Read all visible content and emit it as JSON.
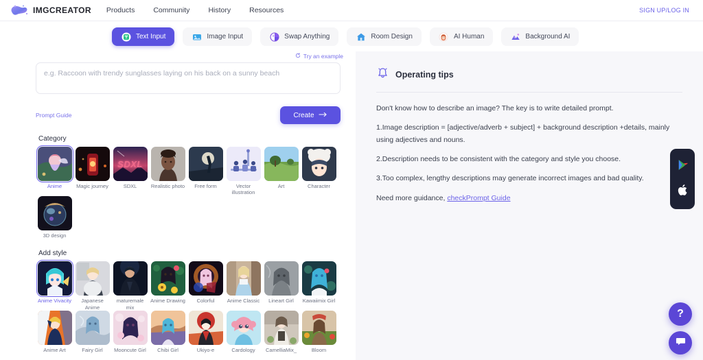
{
  "header": {
    "logo_text": "IMGCREATOR",
    "logo_icon": "blob-logo-icon",
    "nav": [
      {
        "label": "Products"
      },
      {
        "label": "Community"
      },
      {
        "label": "History"
      },
      {
        "label": "Resources"
      }
    ],
    "auth_label": "SIGN UP/LOG IN"
  },
  "tabs": [
    {
      "label": "Text Input",
      "icon": "text-input-icon",
      "active": true
    },
    {
      "label": "Image Input",
      "icon": "image-input-icon",
      "active": false
    },
    {
      "label": "Swap Anything",
      "icon": "swap-anything-icon",
      "active": false
    },
    {
      "label": "Room Design",
      "icon": "room-design-icon",
      "active": false
    },
    {
      "label": "AI Human",
      "icon": "ai-human-icon",
      "active": false
    },
    {
      "label": "Background AI",
      "icon": "background-ai-icon",
      "active": false
    }
  ],
  "prompt": {
    "try_example_label": "Try an example",
    "try_example_icon": "refresh-icon",
    "placeholder": "e.g. Raccoon with trendy sunglasses laying on his back on a sunny beach",
    "value": "",
    "guide_label": "Prompt Guide",
    "create_label": "Create",
    "create_icon": "arrow-right-icon"
  },
  "category": {
    "title": "Category",
    "items": [
      {
        "label": "Anime",
        "selected": true
      },
      {
        "label": "Magic journey",
        "selected": false
      },
      {
        "label": "SDXL",
        "selected": false
      },
      {
        "label": "Realistic photo",
        "selected": false
      },
      {
        "label": "Free form",
        "selected": false
      },
      {
        "label": "Vector illustration",
        "selected": false
      },
      {
        "label": "Art",
        "selected": false
      },
      {
        "label": "Character",
        "selected": false
      },
      {
        "label": "3D design",
        "selected": false
      }
    ]
  },
  "style": {
    "title": "Add style",
    "items": [
      {
        "label": "Anime Vivacity",
        "selected": true
      },
      {
        "label": "Japanese Anime",
        "selected": false
      },
      {
        "label": "maturemale mix",
        "selected": false
      },
      {
        "label": "Anime Drawing",
        "selected": false
      },
      {
        "label": "Colorful",
        "selected": false
      },
      {
        "label": "Anime Classic",
        "selected": false
      },
      {
        "label": "Lineart Girl",
        "selected": false
      },
      {
        "label": "Kawaiimix Girl",
        "selected": false
      },
      {
        "label": "Anime Art",
        "selected": false
      },
      {
        "label": "Fairy Girl",
        "selected": false
      },
      {
        "label": "Mooncute Girl",
        "selected": false
      },
      {
        "label": "Chibi Girl",
        "selected": false
      },
      {
        "label": "Ukiyo-e",
        "selected": false
      },
      {
        "label": "Cardology",
        "selected": false
      },
      {
        "label": "CamelliaMix_",
        "selected": false
      },
      {
        "label": "Bloom",
        "selected": false
      }
    ]
  },
  "tips": {
    "icon": "bell-icon",
    "title": "Operating tips",
    "paragraphs": [
      "Don't know how to describe an image? The key is to write detailed prompt.",
      "1.Image description = [adjective/adverb + subject] + background description +details, mainly using adjectives and nouns.",
      "2.Description needs to be consistent with the category and style you choose.",
      "3.Too complex, lengthy descriptions may generate incorrect images and bad quality."
    ],
    "footer_text": "Need more guidance, ",
    "footer_link": "checkPrompt Guide"
  },
  "floating": {
    "app_dock": [
      {
        "icon": "google-play-icon"
      },
      {
        "icon": "apple-icon"
      }
    ],
    "help_label": "?",
    "help_icon": "question-mark-icon",
    "chat_icon": "chat-bubble-icon"
  },
  "colors": {
    "accent": "#5b52e0",
    "accent_light": "#6b62e8",
    "panel_bg": "#f7f7fa",
    "dock_bg": "#1e2235"
  }
}
